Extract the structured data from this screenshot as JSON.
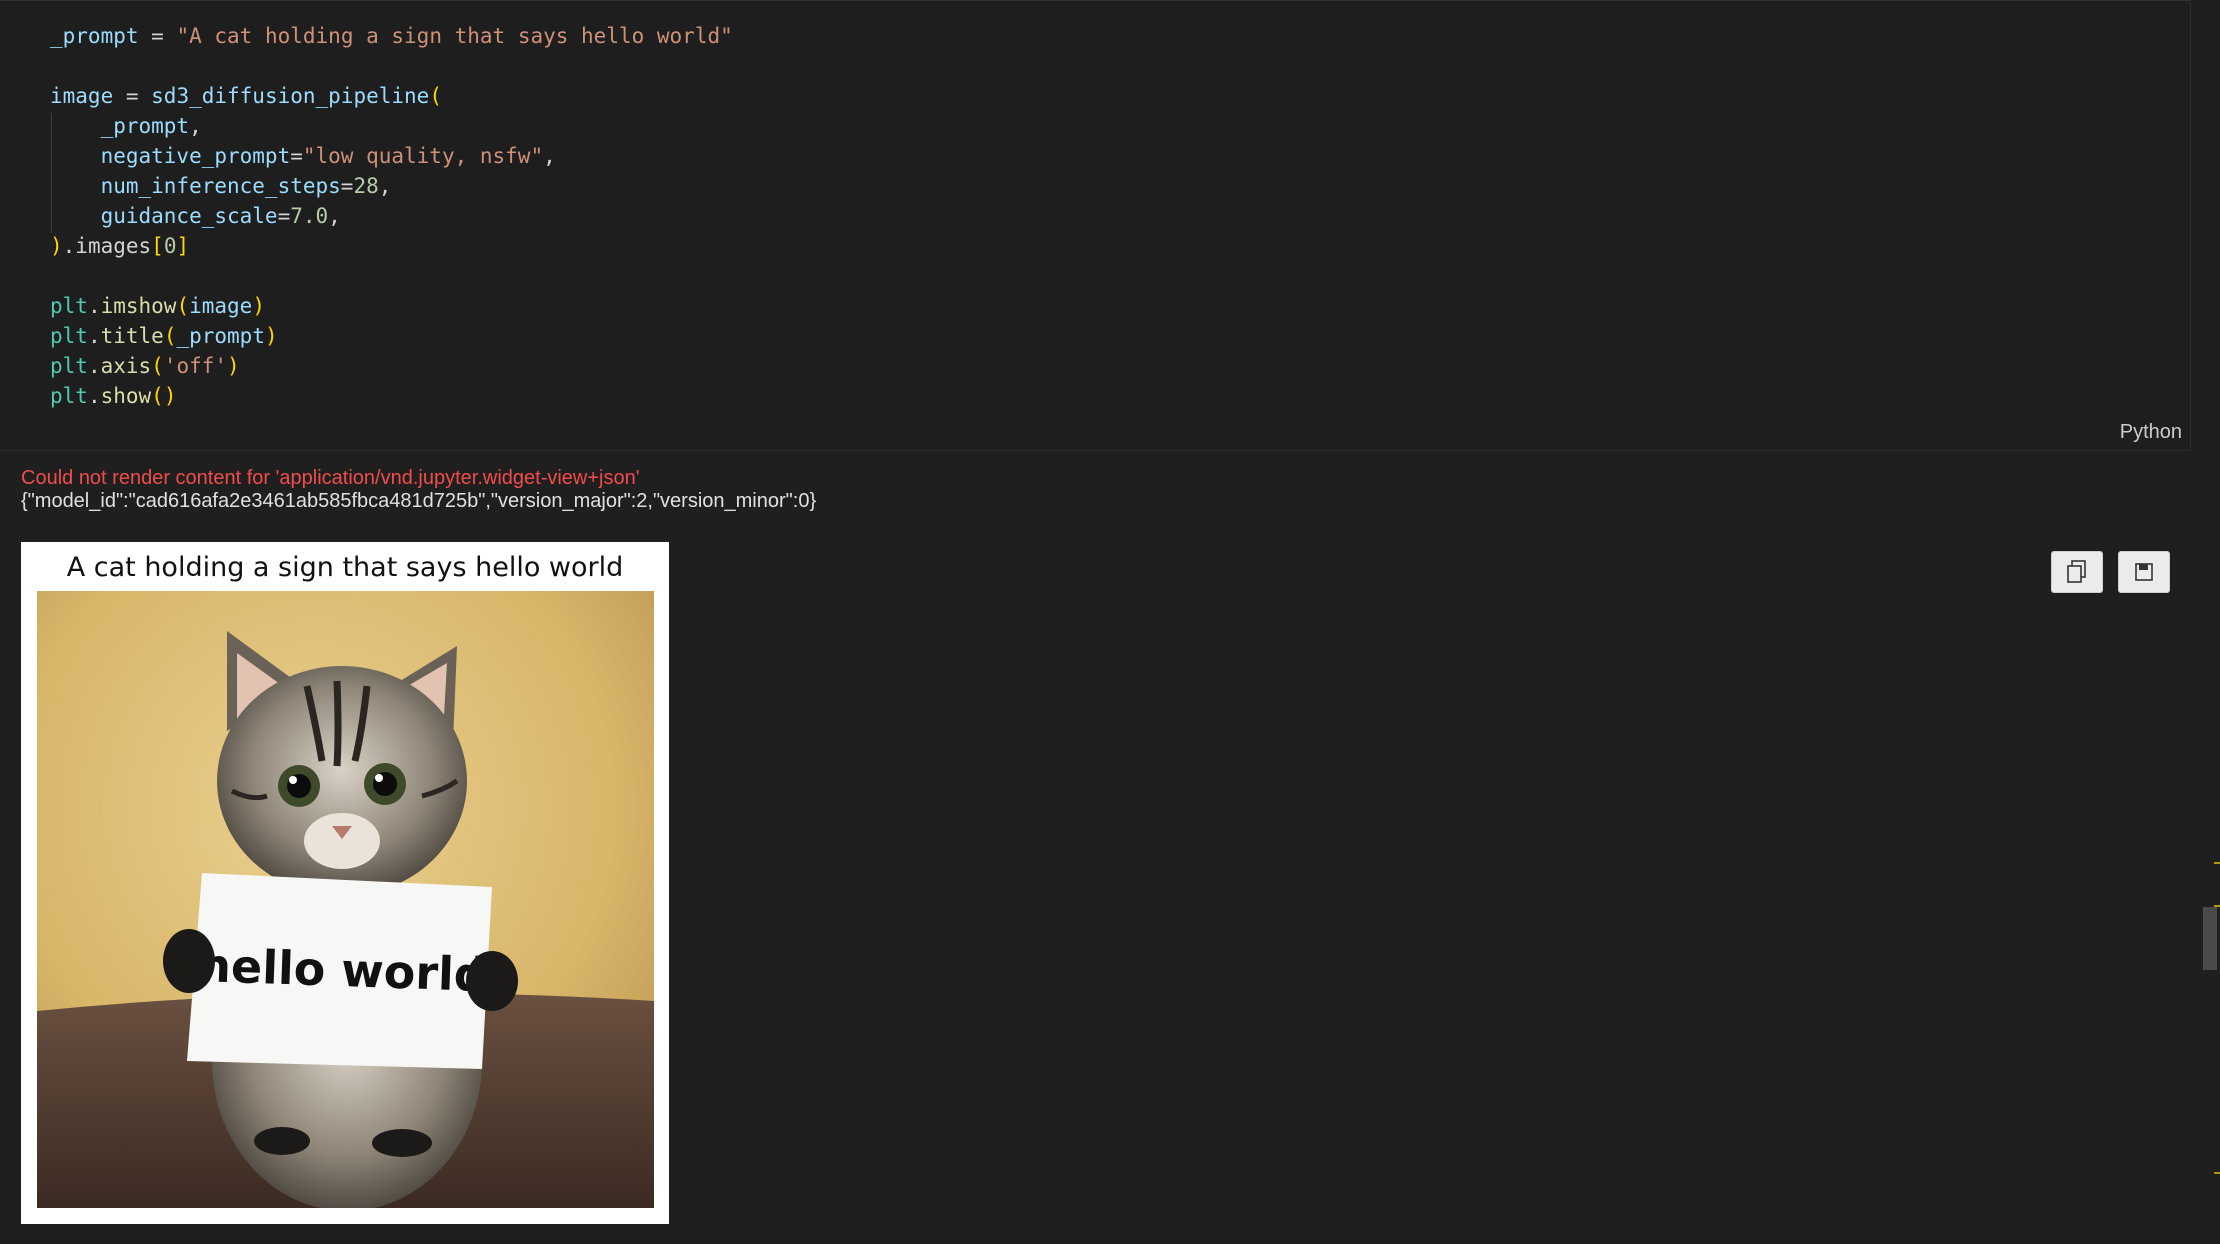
{
  "code": {
    "lines": [
      [
        [
          "_prompt",
          "tk-var"
        ],
        [
          " = ",
          "tk-op"
        ],
        [
          "\"A cat holding a sign that says hello world\"",
          "tk-str"
        ]
      ],
      [],
      [
        [
          "image",
          "tk-var"
        ],
        [
          " = ",
          "tk-op"
        ],
        [
          "sd3_diffusion_pipeline",
          "tk-var"
        ],
        [
          "(",
          "tk-paren"
        ]
      ],
      [
        [
          "    _prompt",
          "tk-var"
        ],
        [
          ",",
          "tk-op"
        ]
      ],
      [
        [
          "    negative_prompt",
          "tk-var"
        ],
        [
          "=",
          "tk-op"
        ],
        [
          "\"low quality, nsfw\"",
          "tk-str"
        ],
        [
          ",",
          "tk-op"
        ]
      ],
      [
        [
          "    num_inference_steps",
          "tk-var"
        ],
        [
          "=",
          "tk-op"
        ],
        [
          "28",
          "tk-num"
        ],
        [
          ",",
          "tk-op"
        ]
      ],
      [
        [
          "    guidance_scale",
          "tk-var"
        ],
        [
          "=",
          "tk-op"
        ],
        [
          "7.0",
          "tk-num"
        ],
        [
          ",",
          "tk-op"
        ]
      ],
      [
        [
          ")",
          "tk-paren"
        ],
        [
          ".images",
          "tk-op"
        ],
        [
          "[",
          "tk-paren"
        ],
        [
          "0",
          "tk-num"
        ],
        [
          "]",
          "tk-paren"
        ]
      ],
      [],
      [
        [
          "plt",
          "tk-mod"
        ],
        [
          ".",
          "tk-op"
        ],
        [
          "imshow",
          "tk-fn"
        ],
        [
          "(",
          "tk-paren"
        ],
        [
          "image",
          "tk-var"
        ],
        [
          ")",
          "tk-paren"
        ]
      ],
      [
        [
          "plt",
          "tk-mod"
        ],
        [
          ".",
          "tk-op"
        ],
        [
          "title",
          "tk-fn"
        ],
        [
          "(",
          "tk-paren"
        ],
        [
          "_prompt",
          "tk-var"
        ],
        [
          ")",
          "tk-paren"
        ]
      ],
      [
        [
          "plt",
          "tk-mod"
        ],
        [
          ".",
          "tk-op"
        ],
        [
          "axis",
          "tk-fn"
        ],
        [
          "(",
          "tk-paren"
        ],
        [
          "'off'",
          "tk-str"
        ],
        [
          ")",
          "tk-paren"
        ]
      ],
      [
        [
          "plt",
          "tk-mod"
        ],
        [
          ".",
          "tk-op"
        ],
        [
          "show",
          "tk-fn"
        ],
        [
          "()",
          "tk-paren"
        ]
      ]
    ],
    "language": "Python"
  },
  "output": {
    "error_message": "Could not render content for 'application/vnd.jupyter.widget-view+json'",
    "widget_json": "{\"model_id\":\"cad616afa2e3461ab585fbca481d725b\",\"version_major\":2,\"version_minor\":0}",
    "figure_title": "A cat holding a sign that says hello world",
    "sign_text": "hello world"
  },
  "toolbar": {
    "copy_icon": "copy-icon",
    "save_icon": "save-icon"
  }
}
